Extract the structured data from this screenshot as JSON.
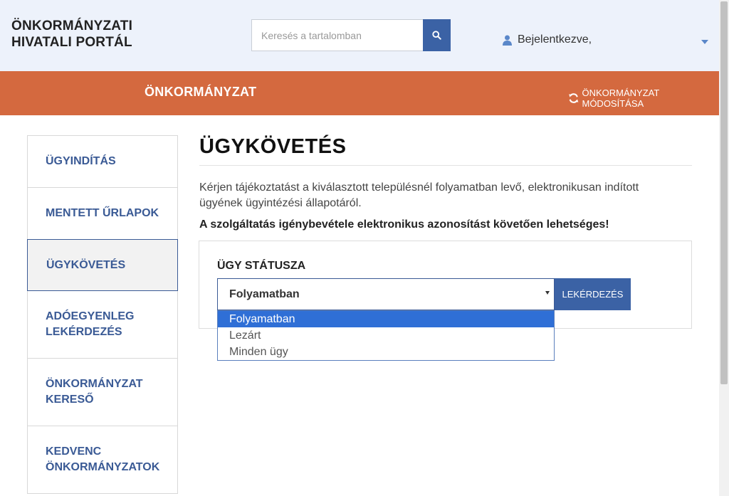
{
  "header": {
    "brand_line1": "ÖNKORMÁNYZATI",
    "brand_line2": "HIVATALI PORTÁL",
    "search_placeholder": "Keresés a tartalomban",
    "user_label": "Bejelentkezve,"
  },
  "bar": {
    "title": "ÖNKORMÁNYZAT",
    "modify_label": "ÖNKORMÁNYZAT MÓDOSÍTÁSA"
  },
  "sidebar": {
    "items": [
      {
        "label": "ÜGYINDÍTÁS"
      },
      {
        "label": "MENTETT ŰRLAPOK"
      },
      {
        "label": "ÜGYKÖVETÉS"
      },
      {
        "label_line1": "ADÓEGYENLEG",
        "label_line2": "LEKÉRDEZÉS"
      },
      {
        "label_line1": "ÖNKORMÁNYZAT",
        "label_line2": "KERESŐ"
      },
      {
        "label_line1": "KEDVENC",
        "label_line2": "ÖNKORMÁNYZATOK"
      }
    ],
    "active_index": 2
  },
  "main": {
    "title": "ÜGYKÖVETÉS",
    "intro": "Kérjen tájékoztatást a kiválasztott településnél folyamatban levő, elektronikusan indított ügyének ügyintézési állapotáról.",
    "notice": "A szolgáltatás igénybevétele elektronikus azonosítást követően lehetséges!",
    "status_label": "ÜGY STÁTUSZA",
    "select_value": "Folyamatban",
    "query_button": "LEKÉRDEZÉS",
    "options": [
      "Folyamatban",
      "Lezárt",
      "Minden ügy"
    ]
  },
  "colors": {
    "header_bg": "#edf2fb",
    "accent_orange": "#d4693f",
    "primary_blue": "#3b62a5",
    "nav_text": "#3a5a95",
    "option_highlight": "#2f6fd6"
  }
}
